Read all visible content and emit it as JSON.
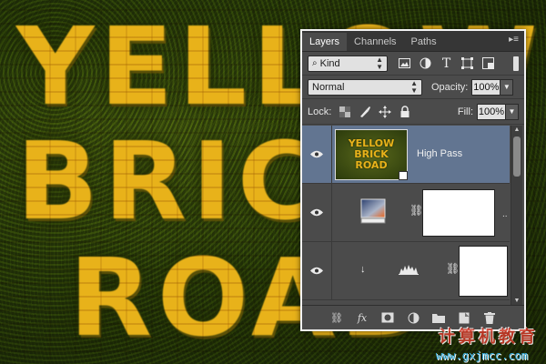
{
  "artwork": {
    "lines": [
      "YELLOW",
      "BRICK",
      "ROAD"
    ],
    "colors": {
      "text": "#e8b21a",
      "grass": "#3b4a12"
    }
  },
  "layers_panel": {
    "tabs": [
      {
        "label": "Layers",
        "active": true
      },
      {
        "label": "Channels",
        "active": false
      },
      {
        "label": "Paths",
        "active": false
      }
    ],
    "menu_icon": "panel-menu-icon",
    "filter": {
      "kind_value": "Kind",
      "icons": [
        "pixel-filter-icon",
        "adjustment-filter-icon",
        "type-filter-icon",
        "shape-filter-icon",
        "smart-object-filter-icon"
      ]
    },
    "blend_mode": "Normal",
    "opacity_label": "Opacity:",
    "opacity_value": "100%",
    "lock_label": "Lock:",
    "lock_icons": [
      "lock-transparent-icon",
      "lock-image-icon",
      "lock-position-icon",
      "lock-all-icon"
    ],
    "fill_label": "Fill:",
    "fill_value": "100%",
    "layers": [
      {
        "name": "High Pass",
        "type": "smart-object",
        "visible": true,
        "selected": true,
        "thumb_lines": [
          "YELLOW",
          "BRICK",
          "ROAD"
        ]
      },
      {
        "name": "",
        "type": "gradient-map-adjustment",
        "visible": true,
        "selected": false
      },
      {
        "name": "",
        "type": "levels-adjustment",
        "visible": true,
        "selected": false
      }
    ],
    "footer_icons": [
      "link-layers-icon",
      "fx-icon",
      "add-mask-icon",
      "adjustment-layer-icon",
      "new-group-icon",
      "new-layer-icon",
      "delete-layer-icon"
    ],
    "fx_label": "fx"
  },
  "watermark": {
    "chinese": "计算机教育",
    "url": "www.gxjmcc.com"
  }
}
